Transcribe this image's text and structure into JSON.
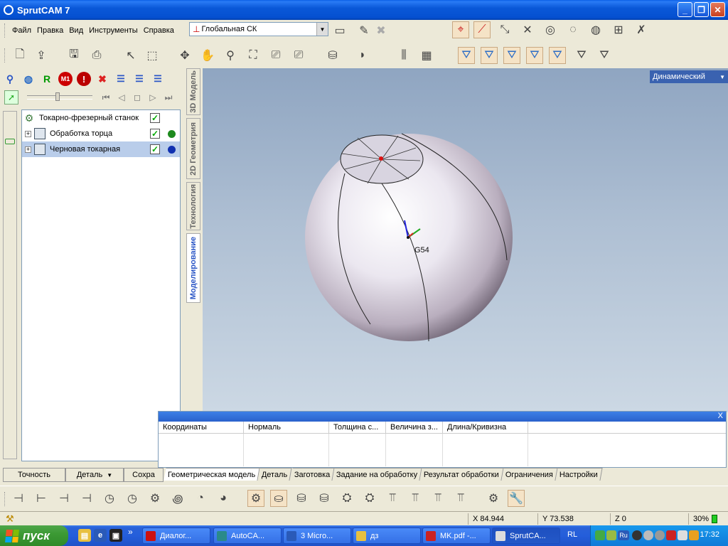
{
  "window": {
    "title": "SprutCAM 7"
  },
  "menu": [
    "Файл",
    "Правка",
    "Вид",
    "Инструменты",
    "Справка"
  ],
  "coordinate_system": {
    "selected": "Глобальная СК"
  },
  "left_toolbar": {
    "r_label": "R",
    "m1_label": "M1",
    "warning_label": "!"
  },
  "tree": {
    "items": [
      {
        "label": "Токарно-фрезерный станок",
        "expandable": false,
        "checked": true,
        "dot_color": null,
        "selected": false
      },
      {
        "label": "Обработка торца",
        "expandable": true,
        "checked": true,
        "dot_color": "#1e8a1e",
        "selected": false
      },
      {
        "label": "Черновая токарная",
        "expandable": true,
        "checked": true,
        "dot_color": "#1030b0",
        "selected": true
      }
    ]
  },
  "vertical_tabs": [
    {
      "label": "3D Модель",
      "active": false
    },
    {
      "label": "2D Геометрия",
      "active": false
    },
    {
      "label": "Технология",
      "active": false
    },
    {
      "label": "Моделирование",
      "active": true
    }
  ],
  "left_bottom_tabs": [
    "Точность",
    "Деталь",
    "Сохра"
  ],
  "viewport": {
    "view_mode": "Динамический",
    "origin_label": "G54"
  },
  "properties": {
    "columns": [
      "Координаты",
      "Нормаль",
      "Толщина с...",
      "Величина з...",
      "Длина/Кривизна"
    ],
    "close_label": "X"
  },
  "property_tabs": [
    {
      "label": "Геометрическая модель",
      "active": true
    },
    {
      "label": "Деталь",
      "active": false
    },
    {
      "label": "Заготовка",
      "active": false
    },
    {
      "label": "Задание на обработку",
      "active": false
    },
    {
      "label": "Результат обработки",
      "active": false
    },
    {
      "label": "Ограничения",
      "active": false
    },
    {
      "label": "Настройки",
      "active": false
    }
  ],
  "status": {
    "x": "X 84.944",
    "y": "Y 73.538",
    "z": "Z 0",
    "zoom": "30%"
  },
  "taskbar": {
    "start_label": "пуск",
    "tasks": [
      {
        "label": "Диалог...",
        "color": "#cc1111",
        "active": false
      },
      {
        "label": "AutoCA...",
        "color": "#2a8a8a",
        "active": false
      },
      {
        "label": "3 Micro...",
        "color": "#2a5ab8",
        "active": false
      },
      {
        "label": "дз",
        "color": "#e8c040",
        "active": false
      },
      {
        "label": "MK.pdf -...",
        "color": "#cc2222",
        "active": false
      },
      {
        "label": "SprutCA...",
        "color": "#dddddd",
        "active": true
      }
    ],
    "language": "RL",
    "tray_language": "Ru",
    "clock": "17:32"
  },
  "colors": {
    "titlebar": "#0a58d8",
    "selection": "#b9cdea",
    "viewport_top": "#8fa5c1",
    "viewport_bottom": "#ccd8e4"
  }
}
